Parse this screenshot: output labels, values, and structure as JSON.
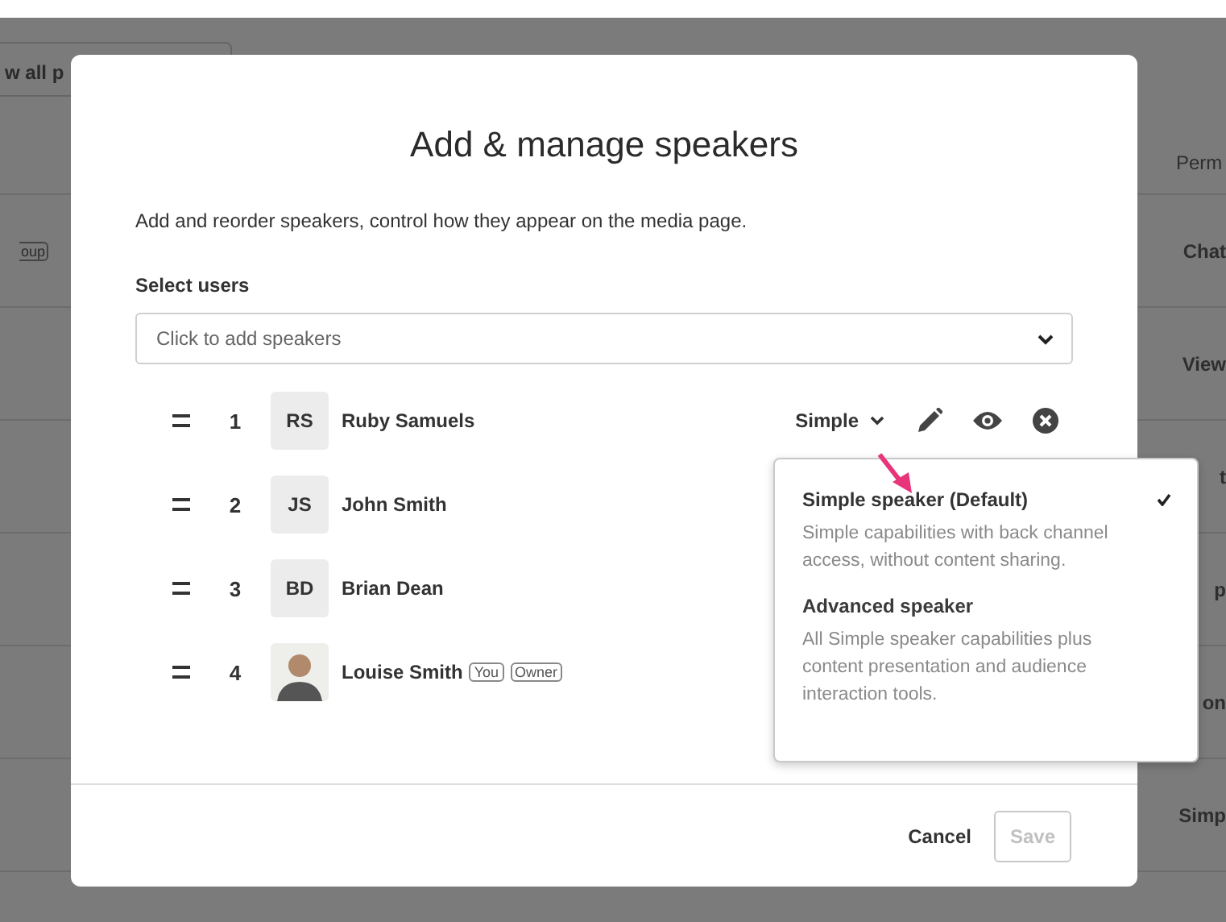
{
  "background": {
    "button": "w all p",
    "tag": "oup",
    "column_header": "Perm",
    "cells": [
      "Chat",
      "View",
      "t",
      "p",
      "on",
      "Simp"
    ]
  },
  "modal": {
    "title": "Add & manage speakers",
    "description": "Add and reorder speakers, control how they appear on the media page.",
    "select_label": "Select users",
    "field": {
      "placeholder": "Click to add speakers"
    },
    "speakers": [
      {
        "index": "1",
        "kind": "initials",
        "initials": "RS",
        "name": "Ruby Samuels",
        "role": "Simple"
      },
      {
        "index": "2",
        "kind": "initials",
        "initials": "JS",
        "name": "John Smith"
      },
      {
        "index": "3",
        "kind": "initials",
        "initials": "BD",
        "name": "Brian Dean"
      },
      {
        "index": "4",
        "kind": "photo",
        "name": "Louise Smith",
        "badges": [
          "You",
          "Owner"
        ]
      }
    ],
    "role_menu": {
      "options": [
        {
          "title": "Simple speaker (Default)",
          "description": "Simple capabilities with back channel access, without content sharing.",
          "selected": true
        },
        {
          "title": "Advanced speaker",
          "description": "All Simple speaker capabilities plus content presentation and audience interaction tools.",
          "selected": false
        }
      ]
    },
    "cancel": "Cancel",
    "save": {
      "label": "Save",
      "disabled": true
    }
  }
}
